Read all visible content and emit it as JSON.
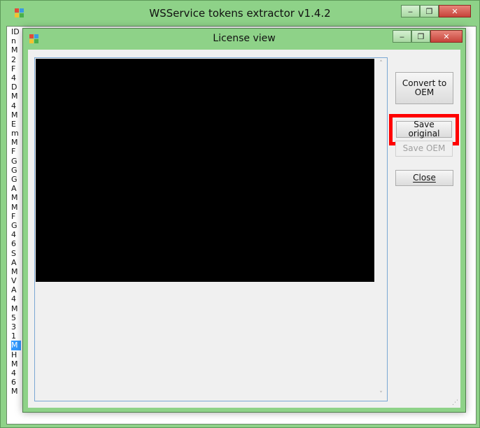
{
  "outer_window": {
    "title": "WSService tokens extractor v1.4.2",
    "minimize_glyph": "‒",
    "maximize_glyph": "❐",
    "close_glyph": "✕",
    "list_items": [
      "ID",
      "n",
      "M",
      "2",
      "F",
      "4",
      "D",
      "M",
      "4",
      "M",
      "E",
      "m",
      "M",
      "F",
      "G",
      "G",
      "G",
      "A",
      "M",
      "M",
      "F",
      "G",
      "4",
      "6",
      "S",
      "A",
      "M",
      "V",
      "A",
      "4",
      "M",
      "5",
      "3",
      "1",
      "M",
      "H",
      "M",
      "4",
      "6",
      "M"
    ],
    "selected_index": 34
  },
  "dialog": {
    "title": "License view",
    "minimize_glyph": "‒",
    "maximize_glyph": "❐",
    "close_glyph": "✕",
    "buttons": {
      "convert": "Convert to OEM",
      "save_original": "Save original",
      "save_oem": "Save OEM",
      "close": "Close"
    },
    "scroll_up": "˄",
    "scroll_down": "˅",
    "grip": "⋰"
  },
  "colors": {
    "highlight": "#ff0000",
    "frame": "#8ed288"
  }
}
